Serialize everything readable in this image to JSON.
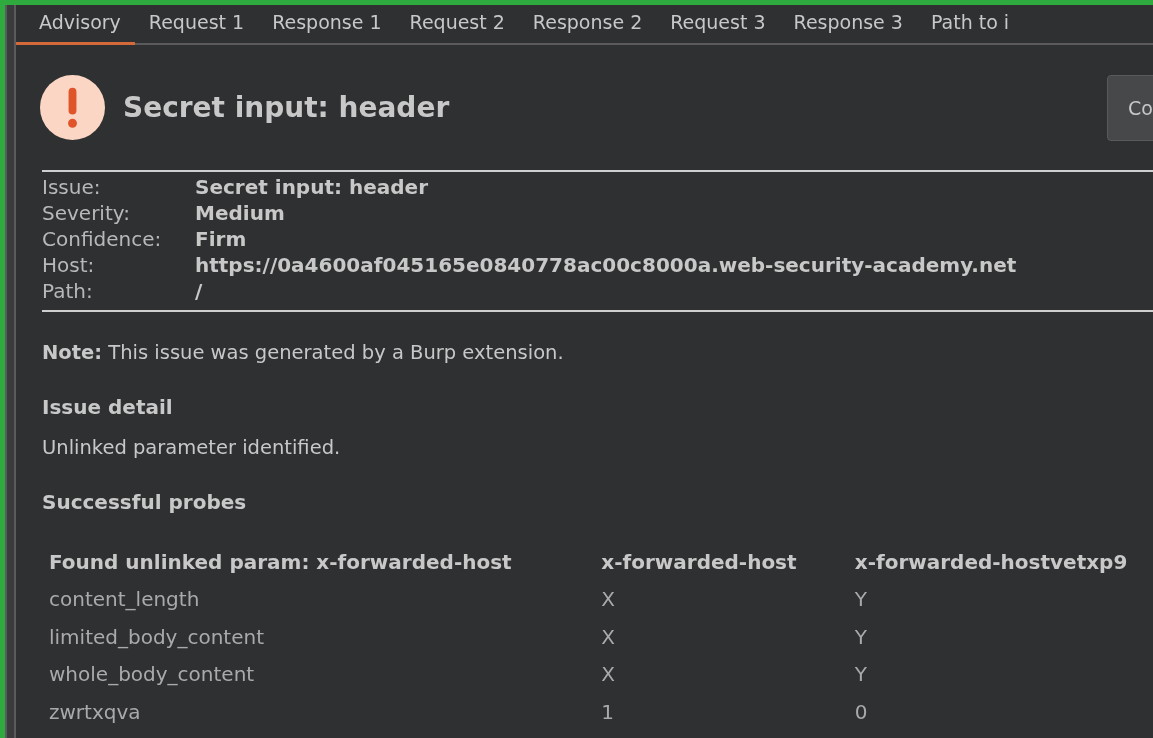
{
  "tabs": [
    {
      "label": "Advisory",
      "selected": true
    },
    {
      "label": "Request 1",
      "selected": false
    },
    {
      "label": "Response 1",
      "selected": false
    },
    {
      "label": "Request 2",
      "selected": false
    },
    {
      "label": "Response 2",
      "selected": false
    },
    {
      "label": "Request 3",
      "selected": false
    },
    {
      "label": "Response 3",
      "selected": false
    },
    {
      "label": "Path to i",
      "selected": false
    }
  ],
  "title": "Secret input: header",
  "button": "Co",
  "fields": [
    {
      "label": "Issue:",
      "value": "Secret input: header"
    },
    {
      "label": "Severity:",
      "value": "Medium"
    },
    {
      "label": "Confidence:",
      "value": "Firm"
    },
    {
      "label": "Host:",
      "value": "https://0a4600af045165e0840778ac00c8000a.web-security-academy.net"
    },
    {
      "label": "Path:",
      "value": "/"
    }
  ],
  "note": "**Note:** This issue was generated by a Burp extension.",
  "sections": [
    {
      "heading": "Issue detail",
      "text": "Unlinked parameter identified."
    },
    {
      "heading": "Successful probes"
    }
  ],
  "table": {
    "columns": [
      "Found unlinked param: x-forwarded-host",
      "x-forwarded-host",
      "x-forwarded-hostvetxp9"
    ],
    "rows": [
      [
        "content_length",
        "X",
        "Y"
      ],
      [
        "limited_body_content",
        "X",
        "Y"
      ],
      [
        "whole_body_content",
        "X",
        "Y"
      ],
      [
        "zwrtxqva",
        "1",
        "0"
      ]
    ]
  }
}
